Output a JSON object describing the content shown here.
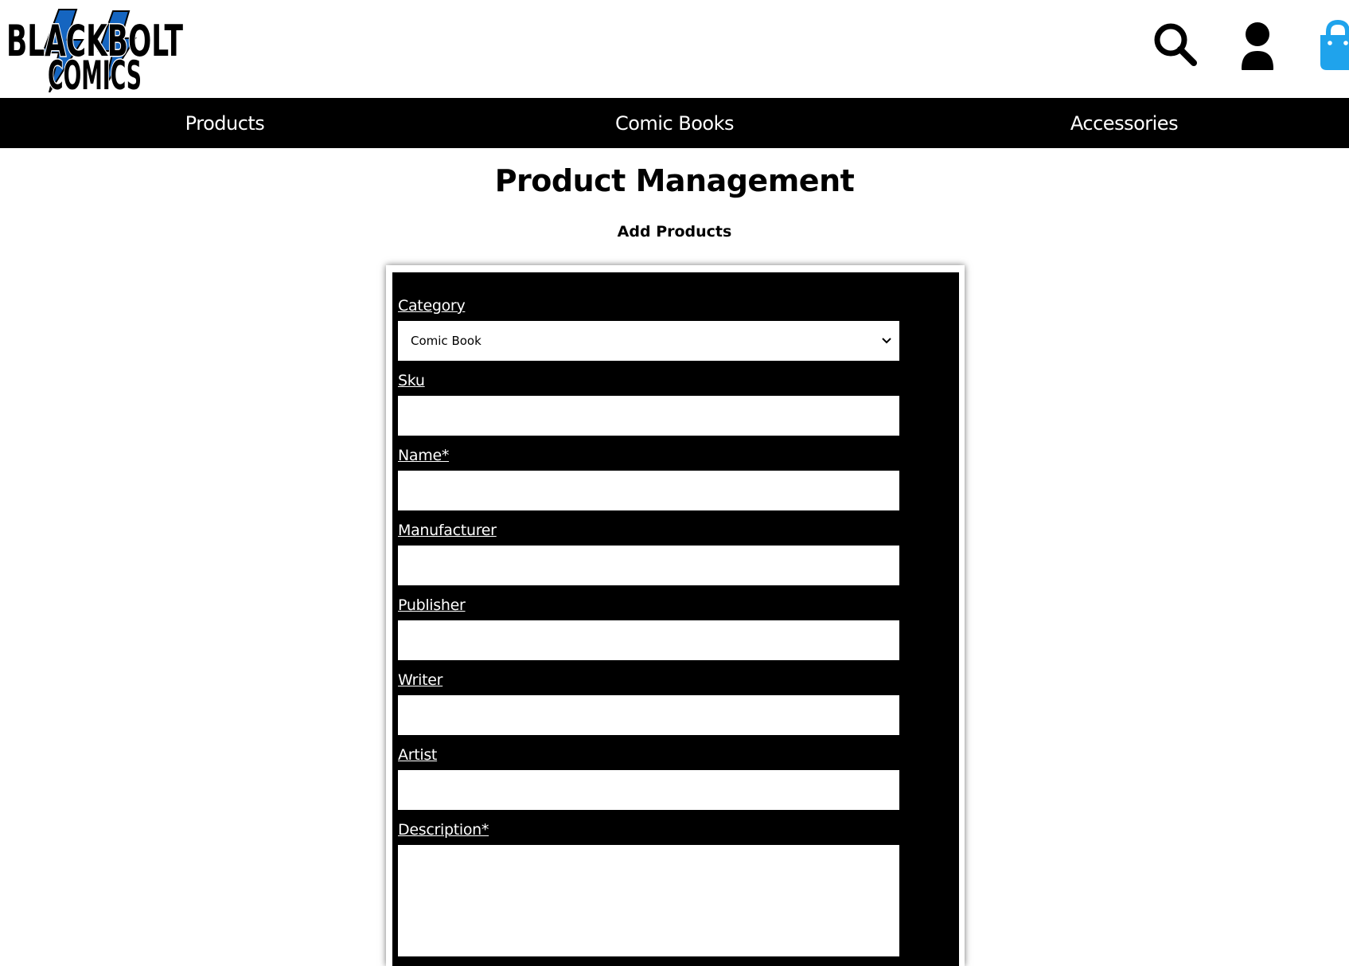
{
  "header": {
    "logo": {
      "line1": "BLACKBOLT",
      "line2": "COMICS"
    },
    "icons": [
      {
        "name": "search-icon",
        "color": "#000000"
      },
      {
        "name": "user-icon",
        "color": "#000000"
      },
      {
        "name": "shopping-bag-icon",
        "color": "#1fa3ec"
      }
    ]
  },
  "nav": {
    "items": [
      {
        "label": "Products"
      },
      {
        "label": "Comic Books"
      },
      {
        "label": "Accessories"
      }
    ]
  },
  "page": {
    "title": "Product Management",
    "subtitle": "Add Products"
  },
  "form": {
    "category": {
      "label": "Category",
      "value": "Comic Book"
    },
    "sku": {
      "label": "Sku",
      "value": ""
    },
    "name": {
      "label": "Name*",
      "value": ""
    },
    "manufacturer": {
      "label": "Manufacturer",
      "value": ""
    },
    "publisher": {
      "label": "Publisher",
      "value": ""
    },
    "writer": {
      "label": "Writer",
      "value": ""
    },
    "artist": {
      "label": "Artist",
      "value": ""
    },
    "description": {
      "label": "Description*",
      "value": ""
    }
  },
  "colors": {
    "nav_background": "#000000",
    "form_background": "#000000",
    "logo_blue": "#1565c0",
    "bag_blue": "#1fa3ec"
  }
}
